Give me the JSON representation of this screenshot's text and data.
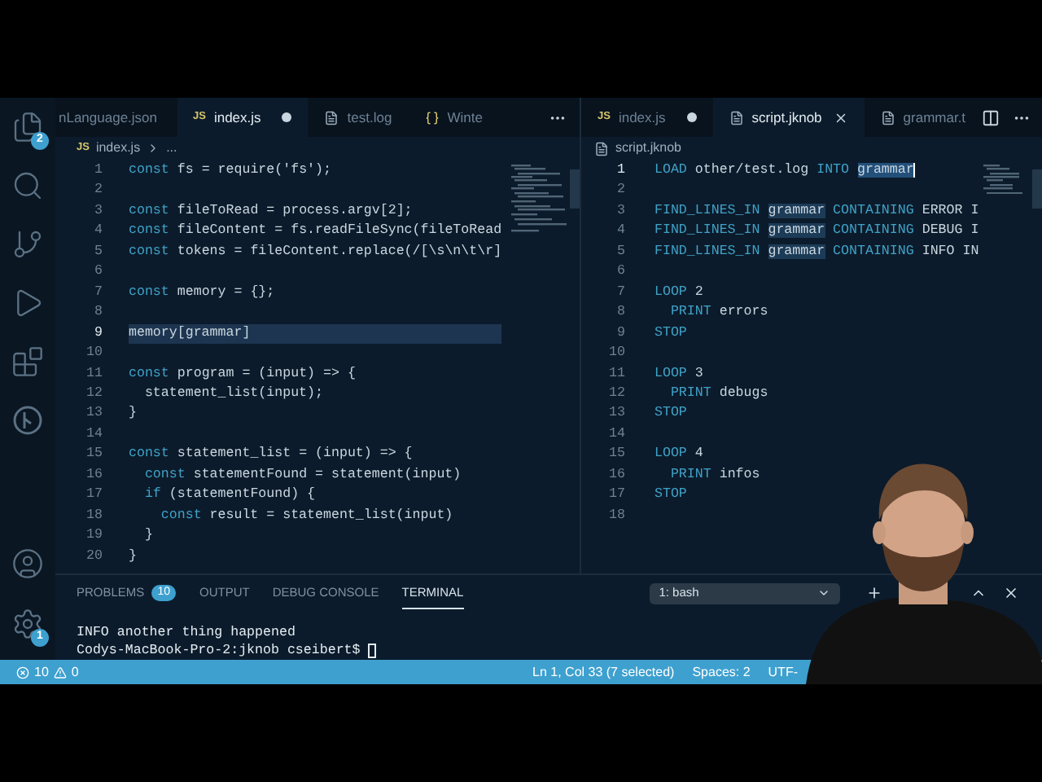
{
  "activity_bar": {
    "items": [
      {
        "kind": "files",
        "badge": "2"
      },
      {
        "kind": "search"
      },
      {
        "kind": "source-control"
      },
      {
        "kind": "debug"
      },
      {
        "kind": "extensions"
      },
      {
        "kind": "branch-circle"
      }
    ],
    "bottom": [
      {
        "kind": "account"
      },
      {
        "kind": "settings",
        "badge": "1"
      }
    ]
  },
  "editors": [
    {
      "tabs": [
        {
          "label": "nLanguage.json",
          "kind": "none",
          "selected": false,
          "modified": false
        },
        {
          "label": "index.js",
          "kind": "js",
          "icon_label": "JS",
          "selected": true,
          "modified": true
        },
        {
          "label": "test.log",
          "kind": "text",
          "selected": false,
          "modified": false
        },
        {
          "label": "Winte",
          "kind": "braces",
          "selected": false,
          "modified": false
        }
      ],
      "breadcrumb": {
        "kind": "js",
        "icon_label": "JS",
        "file": "index.js",
        "trail": "..."
      },
      "lines": [
        {
          "number": "1",
          "tokens": [
            {
              "text": "const",
              "kind": "keyword"
            },
            {
              "text": " fs = require('fs');",
              "kind": "plain"
            }
          ]
        },
        {
          "number": "2"
        },
        {
          "number": "3",
          "tokens": [
            {
              "text": "const",
              "kind": "keyword"
            },
            {
              "text": " fileToRead = process.argv[2];",
              "kind": "plain"
            }
          ]
        },
        {
          "number": "4",
          "tokens": [
            {
              "text": "const",
              "kind": "keyword"
            },
            {
              "text": " fileContent = fs.readFileSync(fileToRead",
              "kind": "plain"
            }
          ]
        },
        {
          "number": "5",
          "tokens": [
            {
              "text": "const",
              "kind": "keyword"
            },
            {
              "text": " tokens = fileContent.replace(/[\\s\\n\\t\\r]",
              "kind": "plain"
            }
          ]
        },
        {
          "number": "6"
        },
        {
          "number": "7",
          "tokens": [
            {
              "text": "const",
              "kind": "keyword"
            },
            {
              "text": " memory = {};",
              "kind": "plain"
            }
          ]
        },
        {
          "number": "8"
        },
        {
          "number": "9",
          "highlighted": true,
          "tokens": [
            {
              "text": "memory[grammar]",
              "kind": "plain"
            }
          ]
        },
        {
          "number": "10"
        },
        {
          "number": "11",
          "tokens": [
            {
              "text": "const",
              "kind": "keyword"
            },
            {
              "text": " program = (input) => {",
              "kind": "plain"
            }
          ]
        },
        {
          "number": "12",
          "tokens": [
            {
              "text": "  statement_list(input);",
              "kind": "plain"
            }
          ]
        },
        {
          "number": "13",
          "tokens": [
            {
              "text": "}",
              "kind": "plain"
            }
          ]
        },
        {
          "number": "14"
        },
        {
          "number": "15",
          "tokens": [
            {
              "text": "const",
              "kind": "keyword"
            },
            {
              "text": " statement_list = (input) => {",
              "kind": "plain"
            }
          ]
        },
        {
          "number": "16",
          "tokens": [
            {
              "text": "  const",
              "kind": "keyword"
            },
            {
              "text": " statementFound = statement(input)",
              "kind": "plain"
            }
          ]
        },
        {
          "number": "17",
          "tokens": [
            {
              "text": "  if",
              "kind": "keyword"
            },
            {
              "text": " (statementFound) {",
              "kind": "plain"
            }
          ]
        },
        {
          "number": "18",
          "tokens": [
            {
              "text": "    const",
              "kind": "keyword"
            },
            {
              "text": " result = statement_list(input)",
              "kind": "plain"
            }
          ]
        },
        {
          "number": "19",
          "tokens": [
            {
              "text": "  }",
              "kind": "plain"
            }
          ]
        },
        {
          "number": "20",
          "tokens": [
            {
              "text": "}",
              "kind": "plain"
            }
          ]
        }
      ]
    },
    {
      "tabs": [
        {
          "label": "index.js",
          "kind": "js",
          "icon_label": "JS",
          "selected": false,
          "modified": true
        },
        {
          "label": "script.jknob",
          "kind": "text",
          "selected": true,
          "modified": false
        },
        {
          "label": "grammar.t",
          "kind": "text",
          "selected": false,
          "modified": false
        }
      ],
      "breadcrumb": {
        "kind": "text",
        "file": "script.jknob"
      },
      "lines": [
        {
          "number": "1",
          "tokens": [
            {
              "text": "LOAD",
              "kind": "keyword"
            },
            {
              "text": " other/test.log ",
              "kind": "plain"
            },
            {
              "text": "INTO ",
              "kind": "keyword"
            },
            {
              "text": "grammar",
              "kind": "selection"
            }
          ]
        },
        {
          "number": "2"
        },
        {
          "number": "3",
          "tokens": [
            {
              "text": "FIND_LINES_IN ",
              "kind": "keyword"
            },
            {
              "text": "grammar",
              "kind": "match"
            },
            {
              "text": " CONTAINING",
              "kind": "keyword"
            },
            {
              "text": " ERROR I",
              "kind": "plain"
            }
          ]
        },
        {
          "number": "4",
          "tokens": [
            {
              "text": "FIND_LINES_IN ",
              "kind": "keyword"
            },
            {
              "text": "grammar",
              "kind": "match"
            },
            {
              "text": " CONTAINING",
              "kind": "keyword"
            },
            {
              "text": " DEBUG I",
              "kind": "plain"
            }
          ]
        },
        {
          "number": "5",
          "tokens": [
            {
              "text": "FIND_LINES_IN ",
              "kind": "keyword"
            },
            {
              "text": "grammar",
              "kind": "match"
            },
            {
              "text": " CONTAINING",
              "kind": "keyword"
            },
            {
              "text": " INFO IN",
              "kind": "plain"
            }
          ]
        },
        {
          "number": "6"
        },
        {
          "number": "7",
          "tokens": [
            {
              "text": "LOOP",
              "kind": "keyword"
            },
            {
              "text": " 2",
              "kind": "plain"
            }
          ]
        },
        {
          "number": "8",
          "tokens": [
            {
              "text": "  PRINT",
              "kind": "keyword"
            },
            {
              "text": " errors",
              "kind": "plain"
            }
          ]
        },
        {
          "number": "9",
          "tokens": [
            {
              "text": "STOP",
              "kind": "keyword"
            }
          ]
        },
        {
          "number": "10"
        },
        {
          "number": "11",
          "tokens": [
            {
              "text": "LOOP",
              "kind": "keyword"
            },
            {
              "text": " 3",
              "kind": "plain"
            }
          ]
        },
        {
          "number": "12",
          "tokens": [
            {
              "text": "  PRINT",
              "kind": "keyword"
            },
            {
              "text": " debugs",
              "kind": "plain"
            }
          ]
        },
        {
          "number": "13",
          "tokens": [
            {
              "text": "STOP",
              "kind": "keyword"
            }
          ]
        },
        {
          "number": "14"
        },
        {
          "number": "15",
          "tokens": [
            {
              "text": "LOOP",
              "kind": "keyword"
            },
            {
              "text": " 4",
              "kind": "plain"
            }
          ]
        },
        {
          "number": "16",
          "tokens": [
            {
              "text": "  PRINT",
              "kind": "keyword"
            },
            {
              "text": " infos",
              "kind": "plain"
            }
          ]
        },
        {
          "number": "17",
          "tokens": [
            {
              "text": "STOP",
              "kind": "keyword"
            }
          ]
        },
        {
          "number": "18"
        }
      ]
    }
  ],
  "panel": {
    "tabs": [
      {
        "label": "PROBLEMS",
        "badge": "10",
        "selected": false
      },
      {
        "label": "OUTPUT",
        "selected": false
      },
      {
        "label": "DEBUG CONSOLE",
        "selected": false
      },
      {
        "label": "TERMINAL",
        "selected": true
      }
    ],
    "terminal_select": "1: bash",
    "terminal_lines": [
      "INFO another thing happened",
      "Codys-MacBook-Pro-2:jknob cseibert$ "
    ]
  },
  "status_bar": {
    "errors": "10",
    "warnings": "0",
    "items": [
      "Ln 1, Col 33 (7 selected)",
      "Spaces: 2",
      "UTF-"
    ]
  }
}
